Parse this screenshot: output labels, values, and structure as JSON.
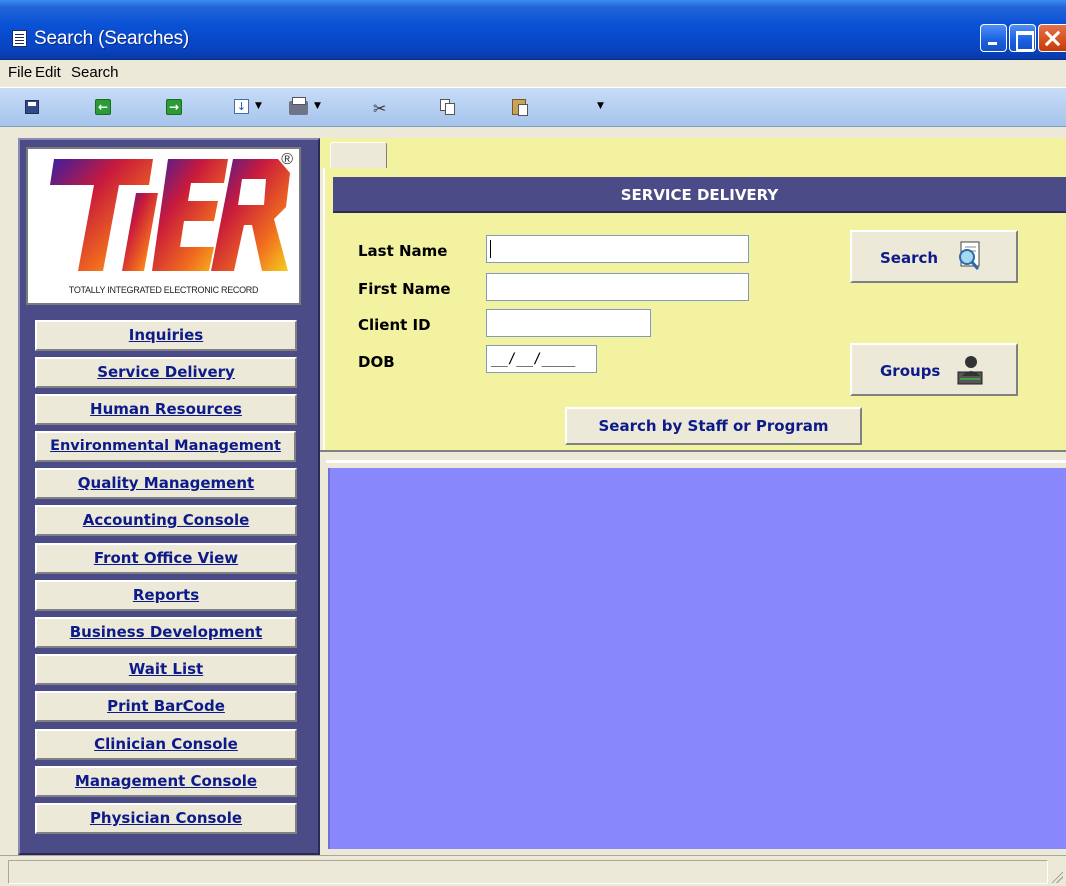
{
  "window": {
    "title": "Search (Searches)",
    "icon": "form-icon"
  },
  "menu": {
    "items": [
      "File",
      "Edit",
      "Search"
    ]
  },
  "toolbar": {
    "buttons": [
      "save-icon",
      "back-icon",
      "forward-icon",
      "download-icon",
      "print-icon",
      "cut-icon",
      "copy-icon",
      "paste-icon"
    ]
  },
  "logo": {
    "wordmark": "TIER",
    "registered": "®",
    "tagline": "TOTALLY INTEGRATED ELECTRONIC RECORD"
  },
  "nav": {
    "items": [
      "Inquiries",
      "Service Delivery",
      "Human Resources",
      "Environmental Management",
      "Quality Management",
      "Accounting Console",
      "Front Office View",
      "Reports",
      "Business Development",
      "Wait List",
      "Print BarCode",
      "Clinician Console",
      "Management Console",
      "Physician Console"
    ]
  },
  "search_form": {
    "header": "SERVICE DELIVERY",
    "fields": {
      "last_name_label": "Last Name",
      "last_name_value": "",
      "first_name_label": "First Name",
      "first_name_value": "",
      "client_id_label": "Client ID",
      "client_id_value": "",
      "dob_label": "DOB",
      "dob_value": "__/__/____"
    },
    "buttons": {
      "search": "Search",
      "groups": "Groups",
      "staff_program": "Search by Staff or Program"
    }
  },
  "colors": {
    "nav_background": "#4a4b87",
    "search_panel": "#f2f2a1",
    "results_panel": "#8888fc",
    "header_bar": "#4a4b87",
    "title_bar": "#0a52d6"
  }
}
